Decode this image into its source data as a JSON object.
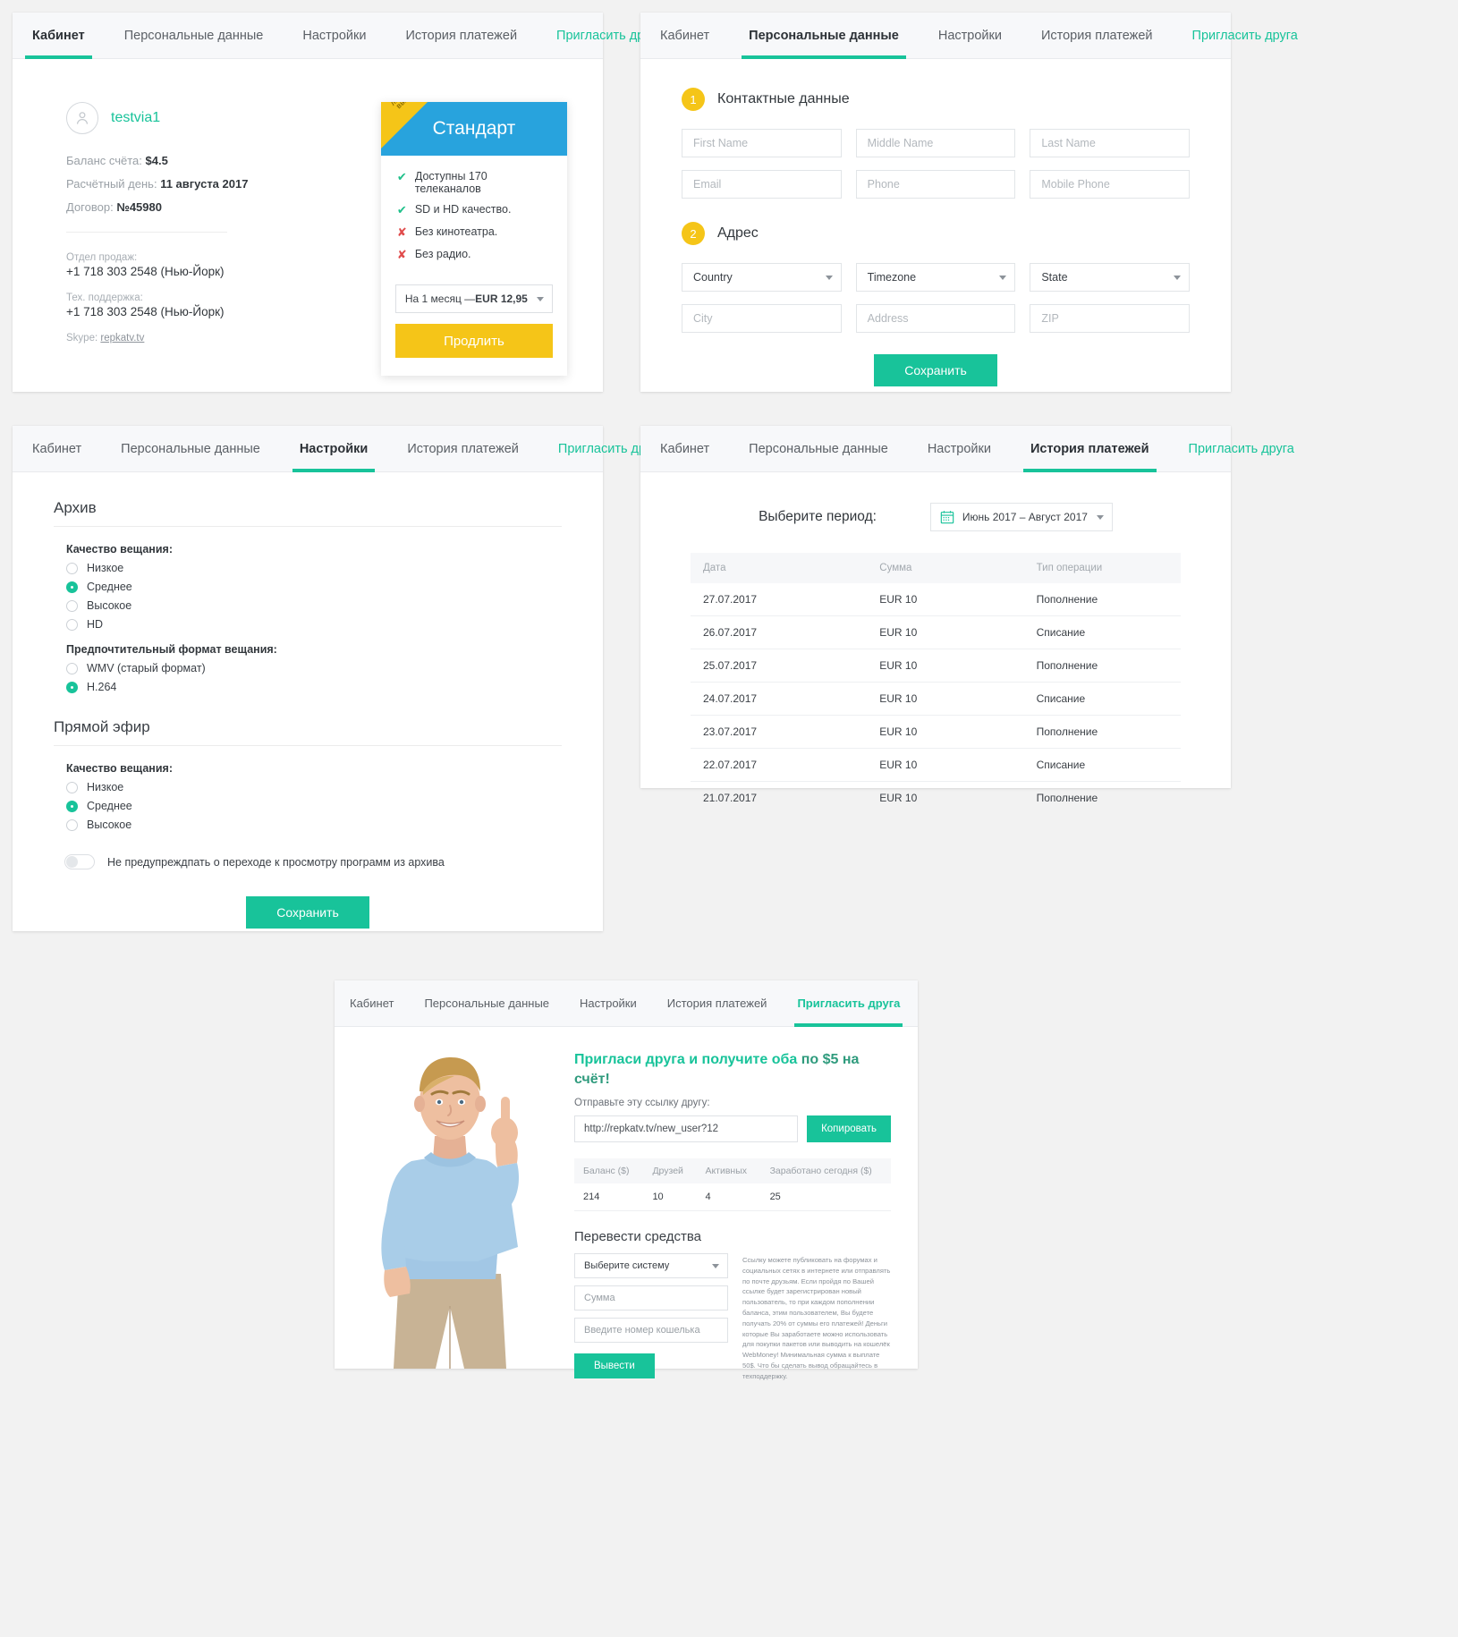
{
  "tabs": {
    "cabinet": "Кабинет",
    "personal": "Персональные данные",
    "settings": "Настройки",
    "history": "История платежей",
    "invite": "Пригласить друга"
  },
  "cabinet": {
    "user_name": "testvia1",
    "avatar_icon": "user-avatar-icon",
    "balance_label": "Баланс счёта:",
    "balance_value": "$4.5",
    "billing_label": "Расчётный день:",
    "billing_value": "11 августа 2017",
    "contract_label": "Договор:",
    "contract_value": "№45980",
    "sales_label": "Отдел продаж:",
    "sales_phone": "+1 718 303 2548 (Нью-Йорк)",
    "support_label": "Тех. поддержка:",
    "support_phone": "+1 718 303 2548 (Нью-Йорк)",
    "skype_label": "Skype:",
    "skype_value": "repkatv.tv",
    "tariff": {
      "ribbon": "ЛУЧШИЙ\nВЫБОР",
      "title": "Стандарт",
      "features": [
        {
          "mark": "ok",
          "text": "Доступны 170 телеканалов"
        },
        {
          "mark": "ok",
          "text": "SD и HD качество."
        },
        {
          "mark": "no",
          "text": "Без кинотеатра."
        },
        {
          "mark": "no",
          "text": "Без радио."
        }
      ],
      "period_prefix": "На 1 месяц — ",
      "period_price": "EUR 12,95",
      "button": "Продлить"
    }
  },
  "personal": {
    "step1_num": "1",
    "step1_title": "Контактные данные",
    "step2_num": "2",
    "step2_title": "Адрес",
    "contact_fields": [
      {
        "placeholder": "First Name",
        "name": "first-name-field",
        "type": "text"
      },
      {
        "placeholder": "Middle Name",
        "name": "middle-name-field",
        "type": "text"
      },
      {
        "placeholder": "Last Name",
        "name": "last-name-field",
        "type": "text"
      },
      {
        "placeholder": "Email",
        "name": "email-field",
        "type": "text"
      },
      {
        "placeholder": "Phone",
        "name": "phone-field",
        "type": "text"
      },
      {
        "placeholder": "Mobile Phone",
        "name": "mobile-phone-field",
        "type": "text"
      }
    ],
    "address_fields": [
      {
        "placeholder": "Country",
        "name": "country-select",
        "type": "select"
      },
      {
        "placeholder": "Timezone",
        "name": "timezone-select",
        "type": "select"
      },
      {
        "placeholder": "State",
        "name": "state-select",
        "type": "select"
      },
      {
        "placeholder": "City",
        "name": "city-field",
        "type": "text"
      },
      {
        "placeholder": "Address",
        "name": "address-field",
        "type": "text"
      },
      {
        "placeholder": "ZIP",
        "name": "zip-field",
        "type": "text"
      }
    ],
    "save_button": "Сохранить"
  },
  "settings": {
    "archive_title": "Архив",
    "archive_quality_label": "Качество вещания:",
    "archive_quality_options": [
      {
        "label": "Низкое",
        "selected": false
      },
      {
        "label": "Среднее",
        "selected": true
      },
      {
        "label": "Высокое",
        "selected": false
      },
      {
        "label": "HD",
        "selected": false
      }
    ],
    "format_label": "Предпочтительный формат вещания:",
    "format_options": [
      {
        "label": "WMV (старый формат)",
        "selected": false
      },
      {
        "label": "H.264",
        "selected": true
      }
    ],
    "live_title": "Прямой эфир",
    "live_quality_label": "Качество вещания:",
    "live_quality_options": [
      {
        "label": "Низкое",
        "selected": false
      },
      {
        "label": "Среднее",
        "selected": true
      },
      {
        "label": "Высокое",
        "selected": false
      }
    ],
    "toggle_label": "Не предупреждпать о переходе к просмотру программ из архива",
    "toggle_on": false,
    "save_button": "Сохранить"
  },
  "history": {
    "period_label": "Выберите период:",
    "period_value": "Июнь 2017 – Август 2017",
    "calendar_icon": "calendar-icon",
    "columns": [
      "Дата",
      "Сумма",
      "Тип операции"
    ],
    "rows": [
      [
        "27.07.2017",
        "EUR 10",
        "Пополнение"
      ],
      [
        "26.07.2017",
        "EUR 10",
        "Списание"
      ],
      [
        "25.07.2017",
        "EUR 10",
        "Пополнение"
      ],
      [
        "24.07.2017",
        "EUR 10",
        "Списание"
      ],
      [
        "23.07.2017",
        "EUR 10",
        "Пополнение"
      ],
      [
        "22.07.2017",
        "EUR 10",
        "Списание"
      ],
      [
        "21.07.2017",
        "EUR 10",
        "Пополнение"
      ]
    ]
  },
  "invite": {
    "headline_a": "Пригласи друга и получите оба ",
    "headline_b": "по $5 на счёт!",
    "subtitle": "Отправьте эту ссылку другу:",
    "link_value": "http://repkatv.tv/new_user?12",
    "copy_button": "Копировать",
    "stats_columns": [
      "Баланс ($)",
      "Друзей",
      "Активных",
      "Заработано сегодня ($)"
    ],
    "stats_row": [
      "214",
      "10",
      "4",
      "25"
    ],
    "transfer_title": "Перевести средства",
    "system_placeholder": "Выберите систему",
    "amount_placeholder": "Сумма",
    "wallet_placeholder": "Введите номер кошелька",
    "withdraw_button": "Вывести",
    "legal_text": "Ссылку можете публиковать на форумах и социальных сетях в интернете или отправлять по почте друзьям. Если пройдя по Вашей ссылке будет зарегистрирован новый пользователь, то при каждом пополнении баланса, этим пользователем, Вы будете получать 20% от суммы его платежей! Деньги которые Вы заработаете можно использовать для покупки пакетов или выводить на кошелёк WebMoney! Минимальная сумма к выплате 50$. Что бы сделать вывод обращайтесь в техподдержку.",
    "photo_alt": "smiling-man-pointing-up-photo"
  },
  "colors": {
    "accent_green": "#18c39a",
    "accent_yellow": "#f5c518",
    "accent_blue": "#28a3dd",
    "danger_red": "#e04b4b"
  }
}
